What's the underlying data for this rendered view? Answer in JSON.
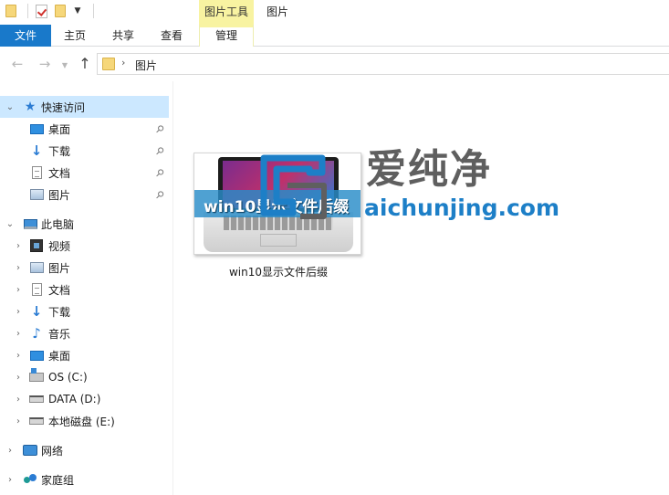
{
  "titlebar": {
    "context_tab_header": "图片工具",
    "window_title": "图片"
  },
  "ribbon": {
    "tabs": {
      "file": "文件",
      "home": "主页",
      "share": "共享",
      "view": "查看",
      "manage": "管理"
    }
  },
  "address": {
    "path": "图片"
  },
  "nav": {
    "quick_access": {
      "label": "快速访问",
      "items": [
        {
          "label": "桌面"
        },
        {
          "label": "下载"
        },
        {
          "label": "文档"
        },
        {
          "label": "图片"
        }
      ]
    },
    "this_pc": {
      "label": "此电脑",
      "items": [
        {
          "label": "视频"
        },
        {
          "label": "图片"
        },
        {
          "label": "文档"
        },
        {
          "label": "下载"
        },
        {
          "label": "音乐"
        },
        {
          "label": "桌面"
        },
        {
          "label": "OS (C:)"
        },
        {
          "label": "DATA (D:)"
        },
        {
          "label": "本地磁盘 (E:)"
        }
      ]
    },
    "network": {
      "label": "网络"
    },
    "homegroup": {
      "label": "家庭组"
    }
  },
  "content": {
    "files": [
      {
        "name": "win10显示文件后缀",
        "thumb_text": "win10显示文件后缀"
      }
    ]
  },
  "watermark": {
    "cn": "爱纯净",
    "en": "aichunjing.com"
  },
  "colors": {
    "file_tab": "#1979ca",
    "context_tab": "#f8f3a1",
    "selection": "#cce8ff",
    "watermark_blue": "#1d7fc7"
  }
}
